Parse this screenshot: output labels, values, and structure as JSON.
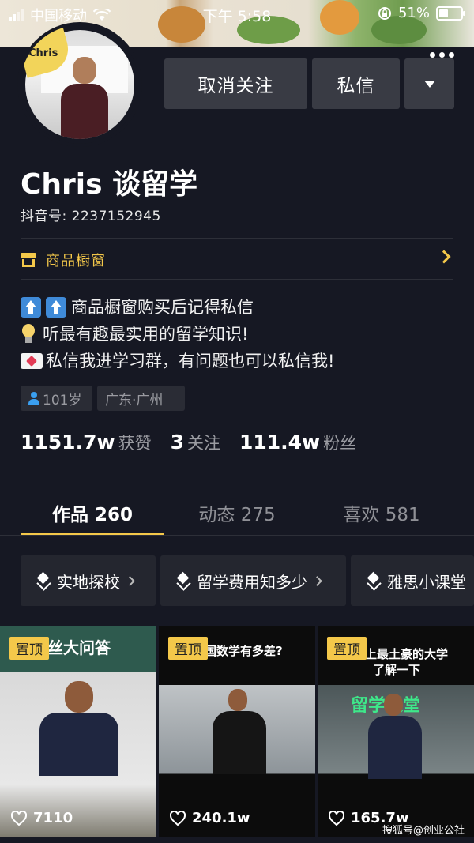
{
  "status_bar": {
    "carrier": "中国移动",
    "time": "下午 5:58",
    "battery": "51%"
  },
  "profile": {
    "avatar_badge": "Chris",
    "name": "Chris 谈留学",
    "douyin_id": "抖音号: 2237152945"
  },
  "actions": {
    "unfollow": "取消关注",
    "message": "私信"
  },
  "shop": {
    "label": "商品橱窗"
  },
  "bio": {
    "line1": "商品橱窗购买后记得私信",
    "line2": "听最有趣最实用的留学知识!",
    "line3": "私信我进学习群，有问题也可以私信我!"
  },
  "tags": {
    "age": "101岁",
    "location": "广东·广州"
  },
  "stats": {
    "likes_value": "1151.7w",
    "likes_label": "获赞",
    "following_value": "3",
    "following_label": "关注",
    "followers_value": "111.4w",
    "followers_label": "粉丝"
  },
  "tabs": [
    {
      "label": "作品 260"
    },
    {
      "label": "动态 275"
    },
    {
      "label": "喜欢 581"
    }
  ],
  "collections": [
    {
      "label": "实地探校"
    },
    {
      "label": "留学费用知多少"
    },
    {
      "label": "雅思小课堂"
    }
  ],
  "videos": [
    {
      "pin": "置顶",
      "likes": "7110",
      "cover_text": "丝大问答"
    },
    {
      "pin": "置顶",
      "likes": "240.1w",
      "cover_text": "国数学有多差?"
    },
    {
      "pin": "置顶",
      "likes": "165.7w",
      "cover_text": "上最土豪的大学",
      "cover_text2": "了解一下",
      "cover_text3": "留学课堂"
    }
  ],
  "watermark": "搜狐号@创业公社"
}
